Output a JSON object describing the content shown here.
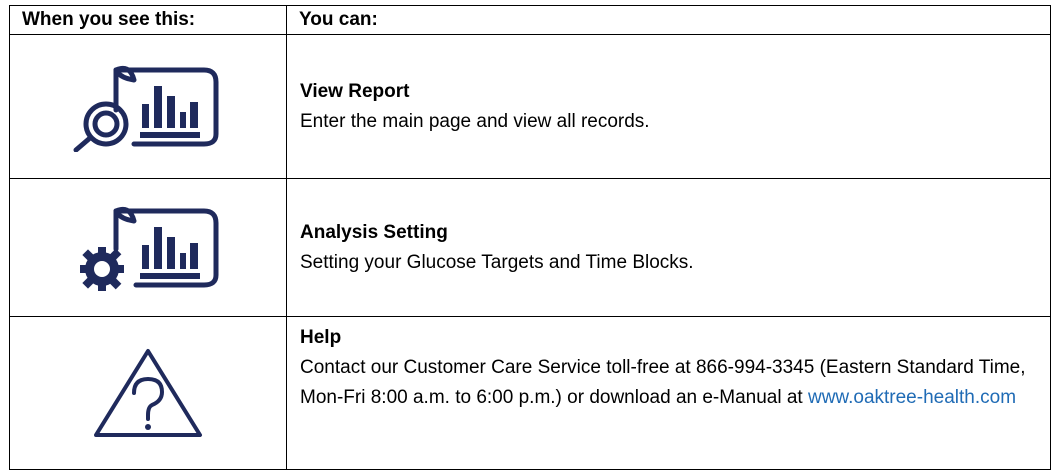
{
  "table": {
    "header_left": "When you see this:",
    "header_right": "You can:",
    "rows": [
      {
        "icon": "view-report-icon",
        "title": "View Report",
        "desc": "Enter the main page and view all records."
      },
      {
        "icon": "analysis-setting-icon",
        "title": "Analysis Setting",
        "desc": "Setting your Glucose Targets and Time Blocks."
      },
      {
        "icon": "help-warning-icon",
        "title": "Help",
        "desc": "Contact our Customer Care Service toll-free at 866-994-3345 (Eastern Standard Time, Mon-Fri 8:00 a.m. to 6:00 p.m.) or download an e-Manual at ",
        "link": "www.oaktree-health.com"
      }
    ]
  },
  "colors": {
    "icon_navy": "#1f2a5c",
    "link_blue": "#1f6bb5"
  }
}
